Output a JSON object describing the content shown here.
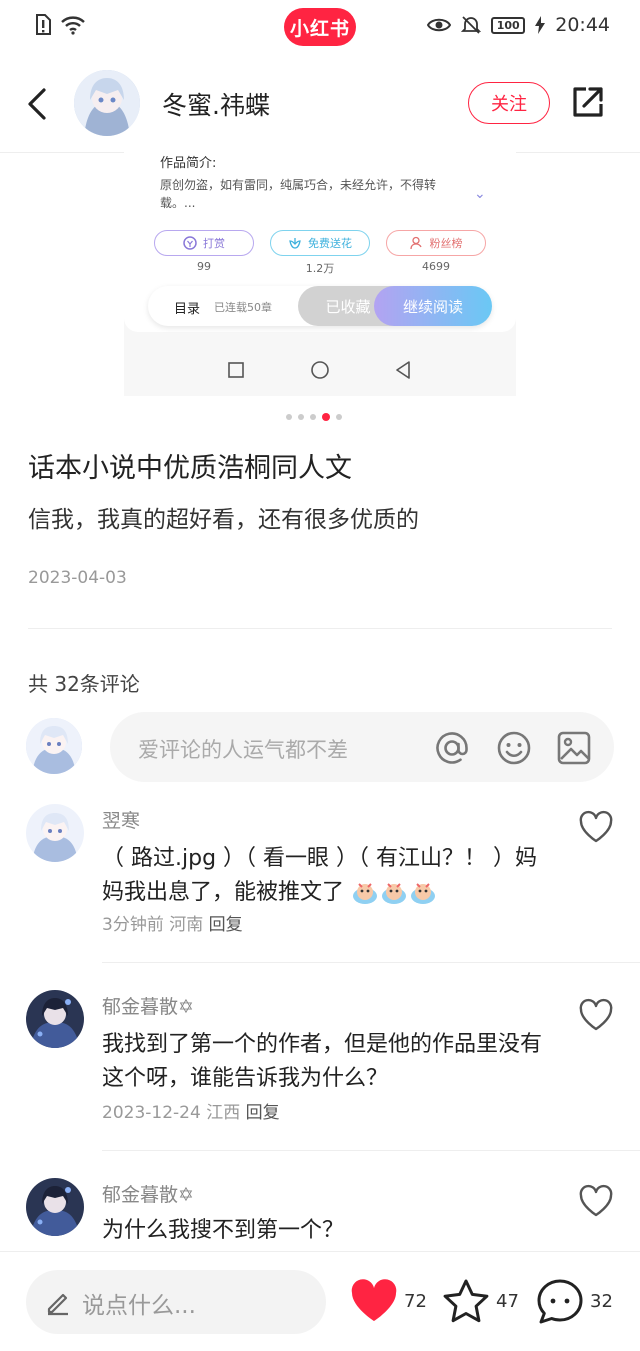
{
  "status_bar": {
    "app_logo": "小红书",
    "battery": "100",
    "time": "20:44"
  },
  "header": {
    "author_name": "冬蜜.祎蝶",
    "follow_label": "关注"
  },
  "preview": {
    "section_title": "作品简介:",
    "description": "原创勿盗，如有雷同，纯属巧合，未经允许，不得转载。...",
    "buttons": [
      {
        "label": "打赏",
        "count": "99"
      },
      {
        "label": "免费送花",
        "count": "1.2万"
      },
      {
        "label": "粉丝榜",
        "count": "4699"
      }
    ],
    "toc_label": "目录",
    "toc_sub": "已连载50章",
    "saved_label": "已收藏",
    "read_label": "继续阅读"
  },
  "carousel": {
    "count": 5,
    "active_index": 3
  },
  "post": {
    "title": "话本小说中优质浩桐同人文",
    "body": "信我，我真的超好看，还有很多优质的",
    "date": "2023-04-03"
  },
  "comments_section": {
    "count_label": "共 32条评论",
    "input_placeholder": "爱评论的人运气都不差",
    "comments": [
      {
        "name": "翌寒",
        "text": "（ 路过.jpg ）（ 看一眼 ）（ 有江山？！ ）妈妈我出息了，能被推文了",
        "time": "3分钟前",
        "location": "河南",
        "reply": "回复"
      },
      {
        "name": "郁金暮散✡",
        "text": "我找到了第一个的作者，但是他的作品里没有这个呀，谁能告诉我为什么？",
        "time": "2023-12-24",
        "location": "江西",
        "reply": "回复"
      },
      {
        "name": "郁金暮散✡",
        "text": "为什么我搜不到第一个？"
      }
    ]
  },
  "bottom_bar": {
    "say_placeholder": "说点什么...",
    "likes": "72",
    "stars": "47",
    "comments": "32"
  },
  "colors": {
    "brand": "#ff2442",
    "like": "#ff2442"
  }
}
